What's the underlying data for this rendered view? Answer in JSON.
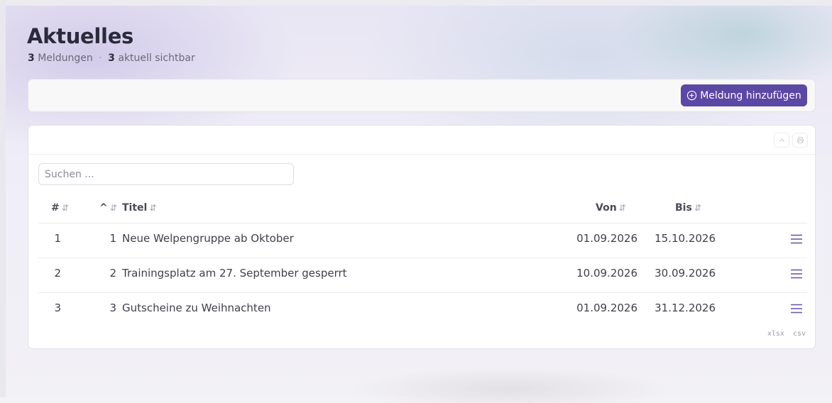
{
  "page": {
    "title": "Aktuelles",
    "count_total": "3",
    "count_total_label": "Meldungen",
    "separator": "·",
    "count_visible": "3",
    "count_visible_label": "aktuell sichtbar"
  },
  "toolbar": {
    "add_label": "Meldung hinzufügen"
  },
  "table": {
    "search_placeholder": "Suchen ...",
    "sort_icon": "⇵",
    "columns": {
      "num": "#",
      "order": "^",
      "title": "Titel",
      "from": "Von",
      "to": "Bis"
    },
    "rows": [
      {
        "num": "1",
        "order": "1",
        "title": "Neue Welpengruppe ab Oktober",
        "from": "01.09.2026",
        "to": "15.10.2026"
      },
      {
        "num": "2",
        "order": "2",
        "title": "Trainingsplatz am 27. September gesperrt",
        "from": "10.09.2026",
        "to": "30.09.2026"
      },
      {
        "num": "3",
        "order": "3",
        "title": "Gutscheine zu Weihnachten",
        "from": "01.09.2026",
        "to": "31.12.2026"
      }
    ],
    "export": [
      "xlsx",
      "csv"
    ]
  },
  "icons": {
    "add": "plus-circle-icon",
    "collapse": "chevron-up-icon",
    "print": "print-icon",
    "row_menu": "hamburger-menu-icon"
  },
  "colors": {
    "accent": "#5b47a4",
    "menu_icon": "#6b5bb0"
  }
}
